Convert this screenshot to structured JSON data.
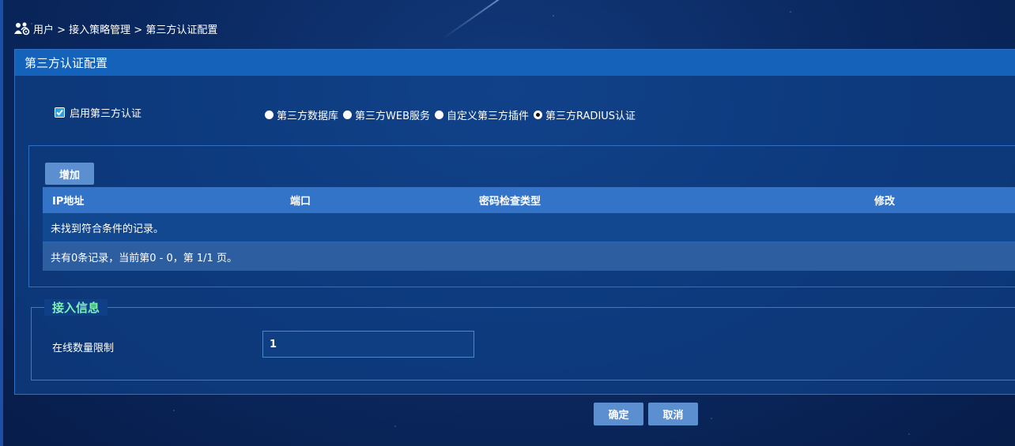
{
  "breadcrumb": {
    "text": "用户 > 接入策略管理 > 第三方认证配置"
  },
  "panel": {
    "title": "第三方认证配置"
  },
  "enable": {
    "label": "启用第三方认证",
    "checked": true
  },
  "auth_types": [
    {
      "label": "第三方数据库",
      "selected": false
    },
    {
      "label": "第三方WEB服务",
      "selected": false
    },
    {
      "label": "自定义第三方插件",
      "selected": false
    },
    {
      "label": "第三方RADIUS认证",
      "selected": true
    }
  ],
  "table": {
    "add_label": "增加",
    "columns": [
      "IP地址",
      "端口",
      "密码检查类型",
      "修改"
    ],
    "empty_text": "未找到符合条件的记录。",
    "footer_text": "共有0条记录，当前第0 - 0，第 1/1 页。"
  },
  "access_info": {
    "legend": "接入信息",
    "online_limit_label": "在线数量限制",
    "online_limit_value": "1"
  },
  "actions": {
    "ok_label": "确定",
    "cancel_label": "取消"
  },
  "colors": {
    "accent": "#7cf0b2",
    "header": "#1462b9",
    "button": "#5b8fcf"
  }
}
